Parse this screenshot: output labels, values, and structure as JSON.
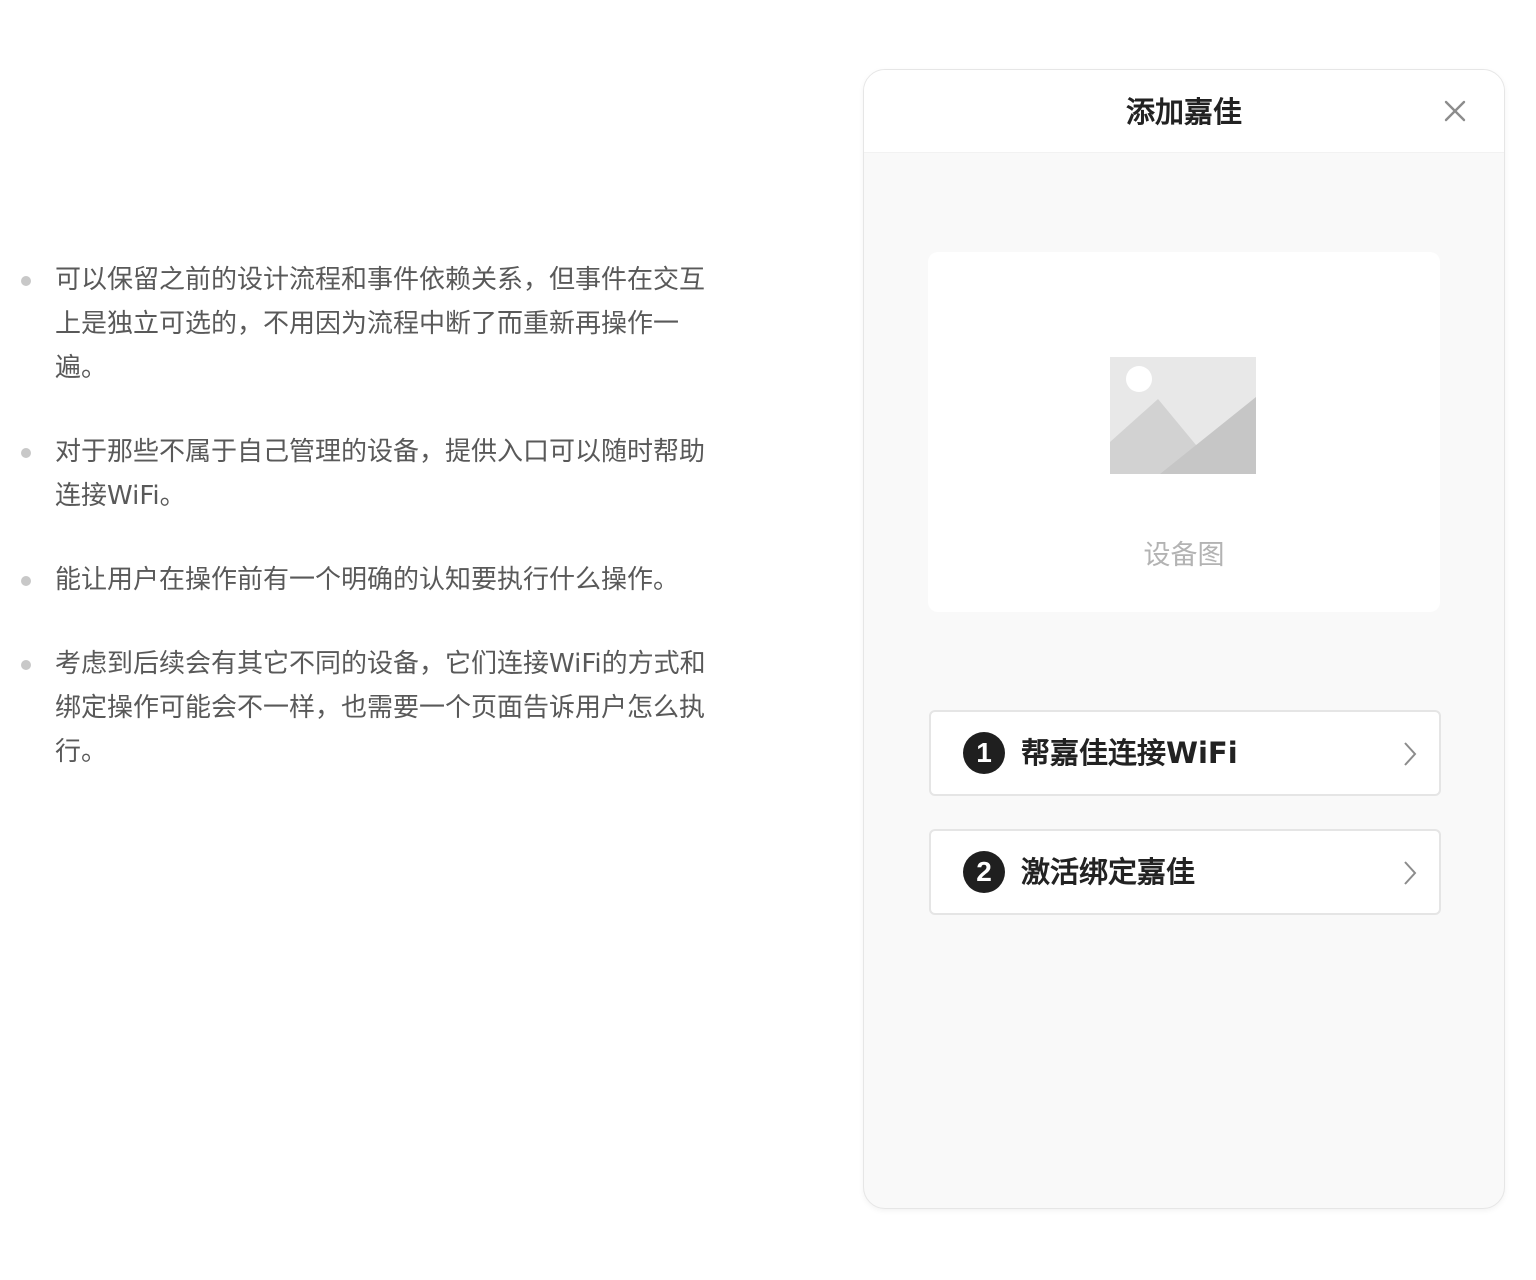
{
  "notes": [
    "可以保留之前的设计流程和事件依赖关系，但事件在交互上是独立可选的，不用因为流程中断了而重新再操作一遍。",
    "对于那些不属于自己管理的设备，提供入口可以随时帮助连接WiFi。",
    "能让用户在操作前有一个明确的认知要执行什么操作。",
    "考虑到后续会有其它不同的设备，它们连接WiFi的方式和绑定操作可能会不一样，也需要一个页面告诉用户怎么执行。"
  ],
  "panel": {
    "title": "添加嘉佳",
    "close_icon": "close-icon",
    "device_caption": "设备图",
    "steps": [
      {
        "number": "1",
        "label": "帮嘉佳连接WiFi"
      },
      {
        "number": "2",
        "label": "激活绑定嘉佳"
      }
    ]
  },
  "colors": {
    "panel_bg": "#f9f9f9",
    "text_muted": "#595959",
    "step_badge": "#1f1f1f"
  }
}
